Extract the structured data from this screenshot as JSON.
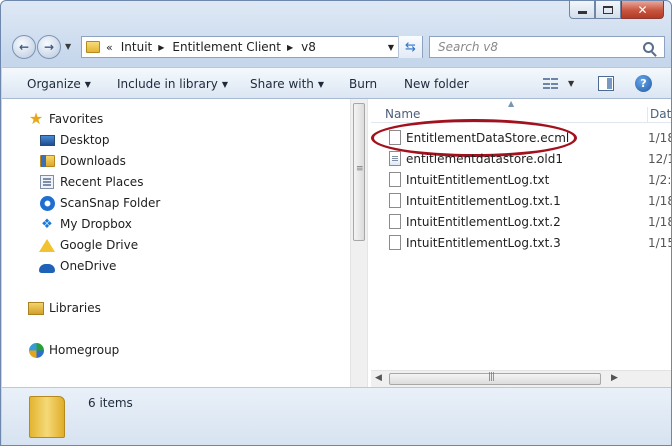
{
  "window": {
    "caption_buttons": {
      "minimize": "minimize",
      "maximize": "maximize",
      "close": "✕"
    }
  },
  "navigation": {
    "breadcrumbs": [
      "Intuit",
      "Entitlement Client",
      "v8"
    ],
    "overflow_chevron": "«",
    "search_placeholder": "Search v8"
  },
  "toolbar": {
    "organize": "Organize",
    "include_in_library": "Include in library",
    "share_with": "Share with",
    "burn": "Burn",
    "new_folder": "New folder",
    "help": "?"
  },
  "sidebar": {
    "favorites_label": "Favorites",
    "favorites": [
      {
        "label": "Desktop",
        "icon": "desktop-icon"
      },
      {
        "label": "Downloads",
        "icon": "downloads-folder-icon"
      },
      {
        "label": "Recent Places",
        "icon": "recent-places-icon"
      },
      {
        "label": "ScanSnap Folder",
        "icon": "scansnap-icon"
      },
      {
        "label": "My Dropbox",
        "icon": "dropbox-icon"
      },
      {
        "label": "Google Drive",
        "icon": "google-drive-icon"
      },
      {
        "label": "OneDrive",
        "icon": "onedrive-icon"
      }
    ],
    "libraries_label": "Libraries",
    "homegroup_label": "Homegroup"
  },
  "file_list": {
    "columns": {
      "name": "Name",
      "date": "Dat"
    },
    "files": [
      {
        "name": "EntitlementDataStore.ecml",
        "date": "1/18",
        "highlighted": true
      },
      {
        "name": "entitlementdatastore.old1",
        "date": "12/1"
      },
      {
        "name": "IntuitEntitlementLog.txt",
        "date": "1/2:"
      },
      {
        "name": "IntuitEntitlementLog.txt.1",
        "date": "1/18"
      },
      {
        "name": "IntuitEntitlementLog.txt.2",
        "date": "1/18"
      },
      {
        "name": "IntuitEntitlementLog.txt.3",
        "date": "1/15"
      }
    ]
  },
  "details": {
    "item_count": "6 items"
  },
  "colors": {
    "highlight_ring": "#a3111d",
    "accent": "#2c73c8"
  }
}
